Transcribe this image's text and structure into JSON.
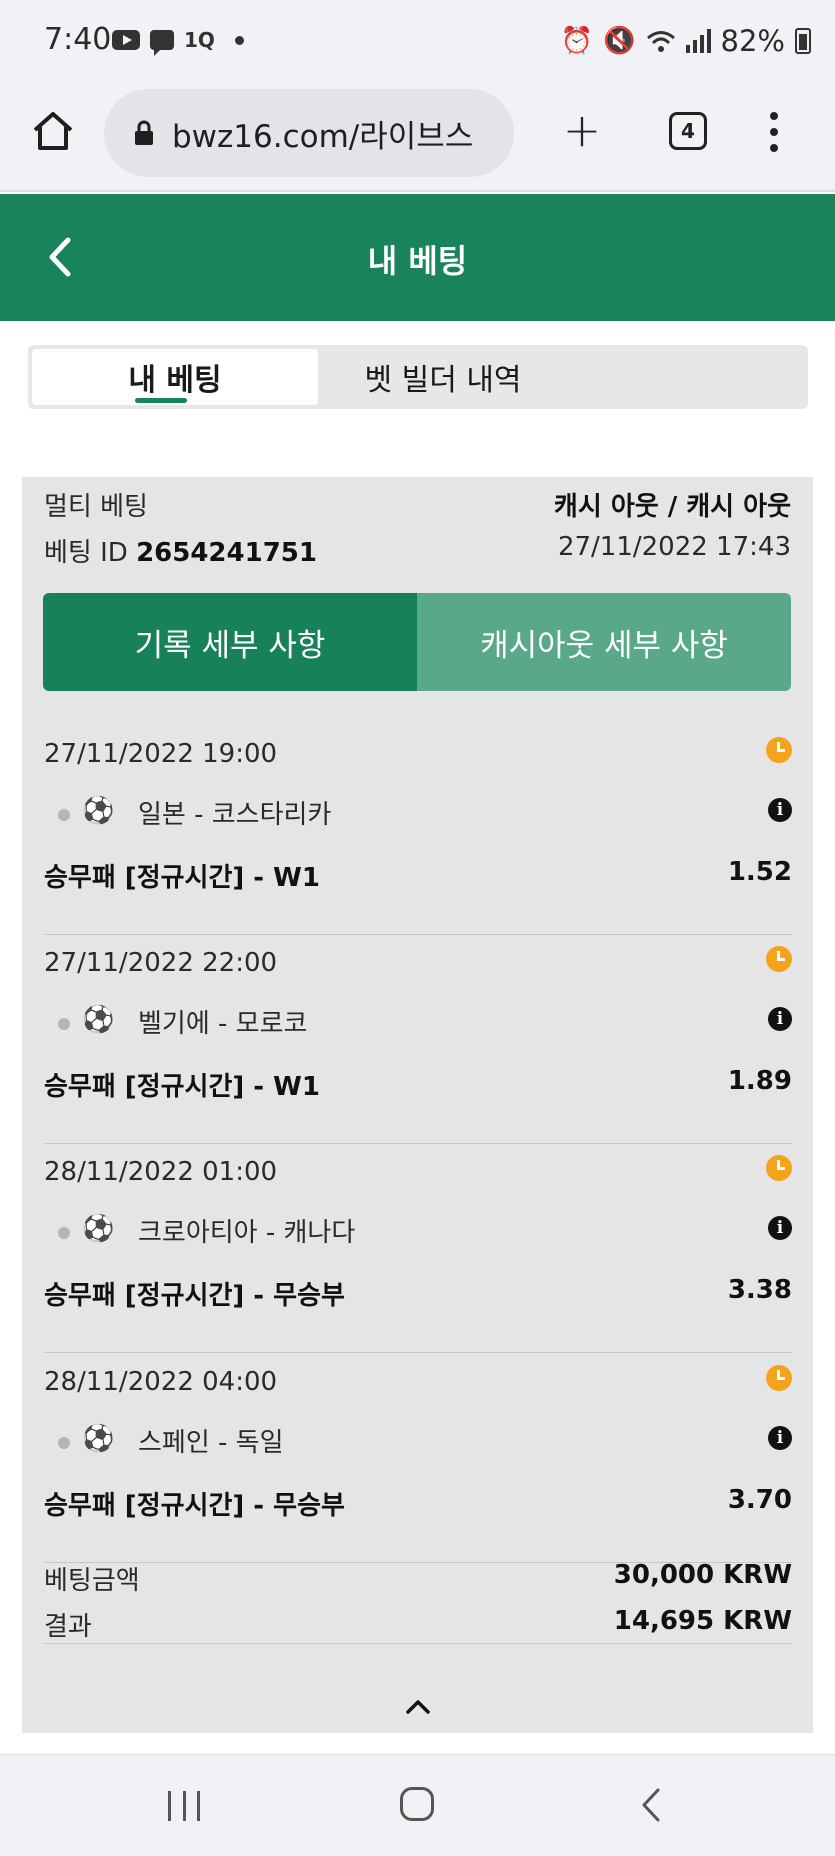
{
  "status_bar": {
    "time": "7:40",
    "notif_1q": "1Q",
    "battery": "82%",
    "icons": [
      "youtube-icon",
      "chat-icon",
      "alarm-icon",
      "mute-icon",
      "wifi-icon",
      "signal-icon",
      "battery-icon"
    ]
  },
  "browser": {
    "url": "bwz16.com/라이브스",
    "tab_count": "4",
    "plus": "+"
  },
  "header": {
    "title": "내 베팅"
  },
  "tabs": [
    {
      "label": "내 베팅",
      "active": true
    },
    {
      "label": "벳 빌더 내역",
      "active": false
    }
  ],
  "bet_card": {
    "type_label": "멀티 베팅",
    "status": "캐시 아웃 / 캐시 아웃",
    "id_label": "베팅 ID",
    "id_value": "2654241751",
    "datetime": "27/11/2022 17:43",
    "btn_history": "기록 세부 사항",
    "btn_cashout": "캐시아웃 세부 사항",
    "selections": [
      {
        "date": "27/11/2022 19:00",
        "match": "일본 - 코스타리카",
        "market": "승무패 [정규시간] - W1",
        "odds": "1.52"
      },
      {
        "date": "27/11/2022 22:00",
        "match": "벨기에 - 모로코",
        "market": "승무패 [정규시간] - W1",
        "odds": "1.89"
      },
      {
        "date": "28/11/2022 01:00",
        "match": "크로아티아 - 캐나다",
        "market": "승무패 [정규시간] - 무승부",
        "odds": "3.38"
      },
      {
        "date": "28/11/2022 04:00",
        "match": "스페인 - 독일",
        "market": "승무패 [정규시간] - 무승부",
        "odds": "3.70"
      }
    ],
    "stake_label": "베팅금액",
    "stake_value": "30,000 KRW",
    "result_label": "결과",
    "result_value": "14,695 KRW"
  },
  "colors": {
    "brand_green": "#19835c",
    "button_light_green": "#5aa88a",
    "clock_orange": "#f5a21c"
  }
}
